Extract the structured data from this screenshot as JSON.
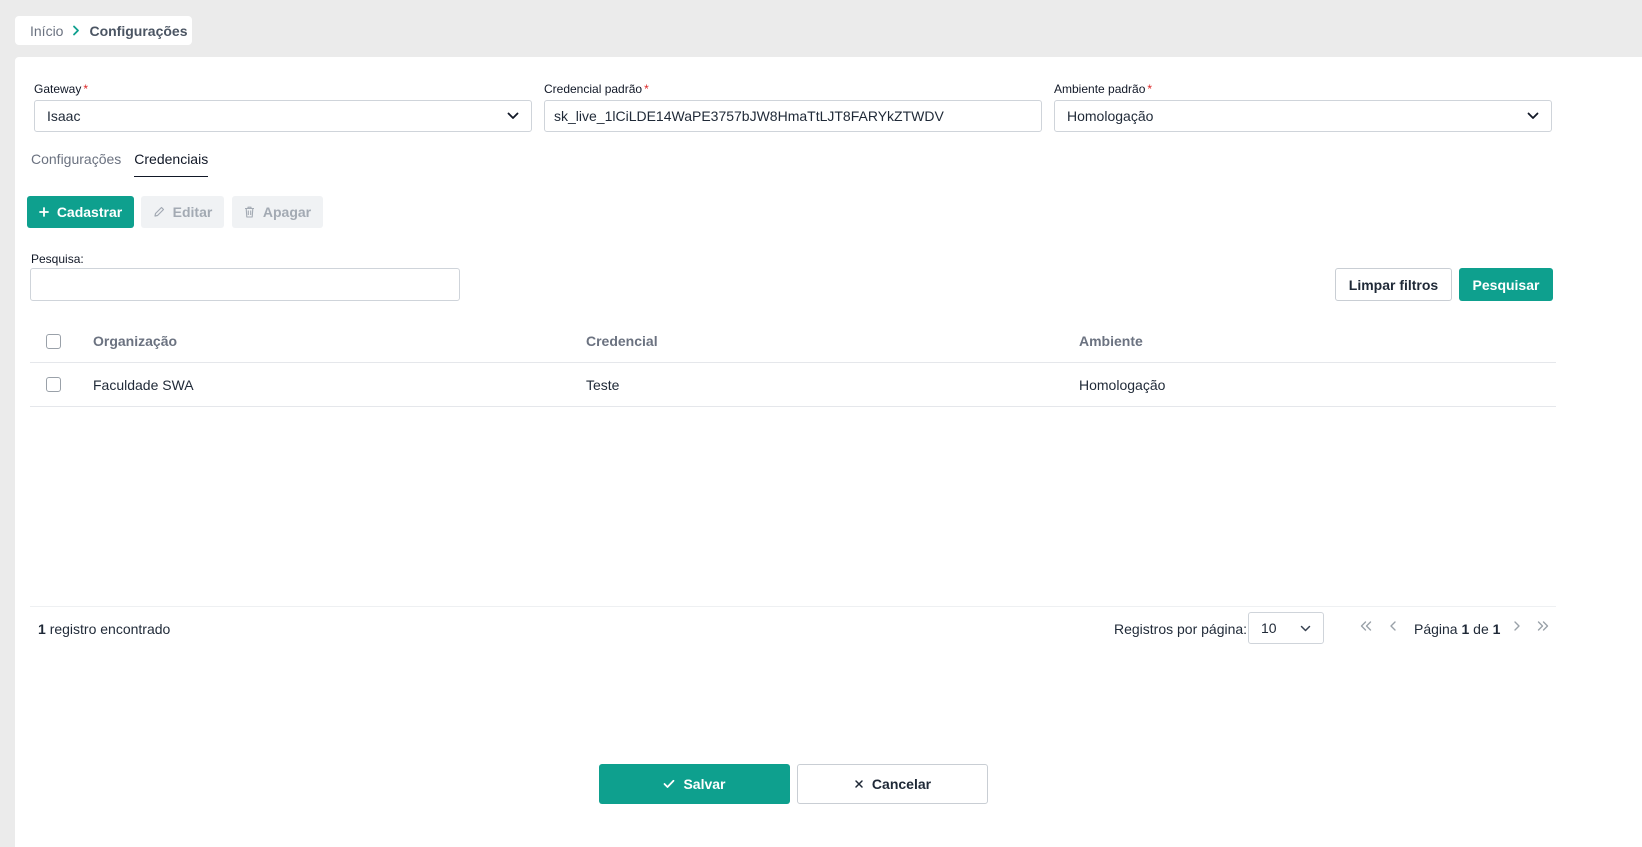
{
  "breadcrumb": {
    "home": "Início",
    "current": "Configurações"
  },
  "form": {
    "gateway": {
      "label": "Gateway",
      "required": "*",
      "value": "Isaac"
    },
    "credential": {
      "label": "Credencial padrão",
      "required": "*",
      "value": "sk_live_1lCiLDE14WaPE3757bJW8HmaTtLJT8FARYkZTWDV"
    },
    "environment": {
      "label": "Ambiente padrão",
      "required": "*",
      "value": "Homologação"
    }
  },
  "tabs": [
    {
      "label": "Configurações"
    },
    {
      "label": "Credenciais"
    }
  ],
  "toolbar": {
    "create_label": "Cadastrar",
    "edit_label": "Editar",
    "delete_label": "Apagar"
  },
  "search": {
    "label": "Pesquisa:",
    "value": "",
    "clear_label": "Limpar filtros",
    "search_label": "Pesquisar"
  },
  "table": {
    "columns": [
      "Organização",
      "Credencial",
      "Ambiente"
    ],
    "rows": [
      {
        "organizacao": "Faculdade SWA",
        "credencial": "Teste",
        "ambiente": "Homologação"
      }
    ]
  },
  "pagination": {
    "count": "1",
    "count_suffix": "registro encontrado",
    "per_page_label": "Registros por página:",
    "per_page_value": "10",
    "page_prefix": "Página",
    "current_page": "1",
    "of_label": "de",
    "total_pages": "1"
  },
  "actions": {
    "save_label": "Salvar",
    "cancel_label": "Cancelar"
  },
  "colors": {
    "accent": "#0ea08e",
    "required": "#dc2626"
  },
  "icons": {
    "breadcrumb_sep": "chevron-right-icon",
    "select": "chevron-down-icon",
    "create": "plus-icon",
    "edit": "pencil-icon",
    "delete": "trash-icon",
    "first": "chevrons-left-icon",
    "prev": "chevron-left-icon",
    "next": "chevron-right-icon",
    "last": "chevrons-right-icon",
    "save": "check-icon",
    "cancel": "close-icon"
  }
}
